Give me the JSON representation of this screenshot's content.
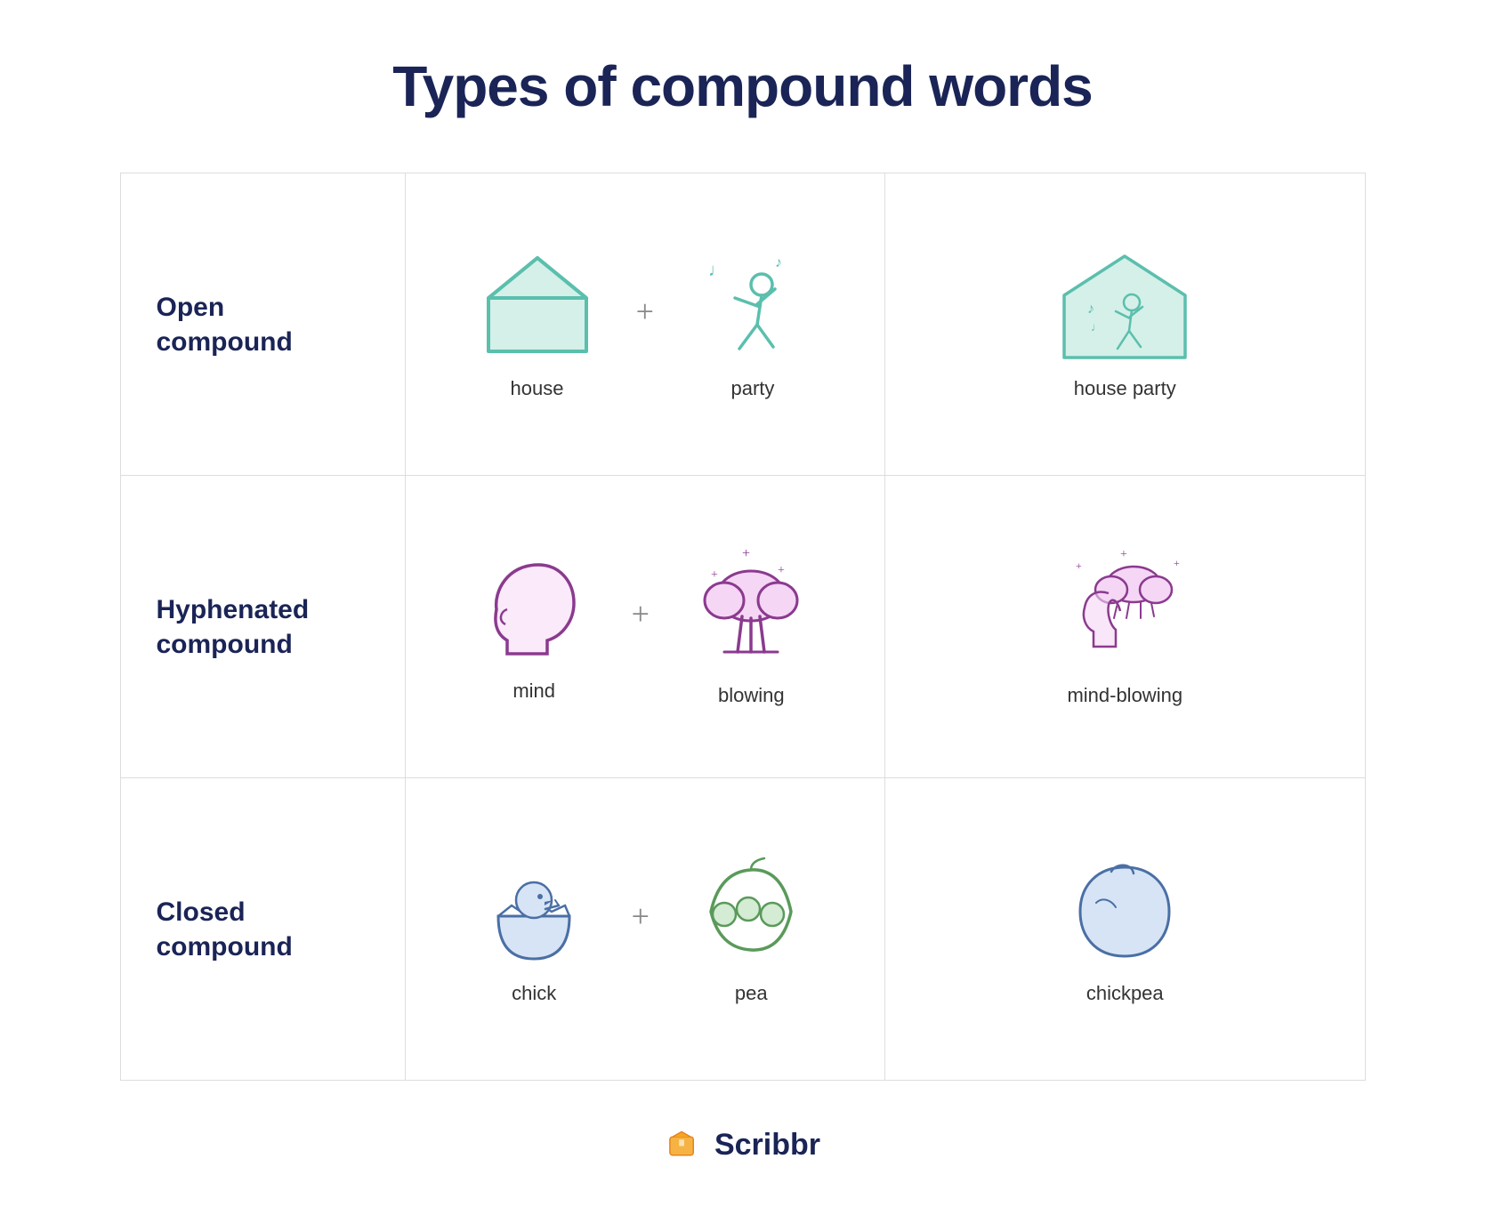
{
  "title": "Types of compound words",
  "rows": [
    {
      "label": "Open\ncompound",
      "word1": "house",
      "word2": "party",
      "result": "house party",
      "type": "open"
    },
    {
      "label": "Hyphenated\ncompound",
      "word1": "mind",
      "word2": "blowing",
      "result": "mind-blowing",
      "type": "hyphenated"
    },
    {
      "label": "Closed\ncompound",
      "word1": "chick",
      "word2": "pea",
      "result": "chickpea",
      "type": "closed"
    }
  ],
  "footer": {
    "brand": "Scribbr"
  },
  "colors": {
    "teal": "#5bbfad",
    "purple": "#8b3a8f",
    "navy": "#1a2456",
    "blue": "#4a6fa5",
    "light_teal_fill": "#d4f0e8",
    "light_purple_fill": "#f5d6f5",
    "light_blue_fill": "#d6e4f5"
  }
}
